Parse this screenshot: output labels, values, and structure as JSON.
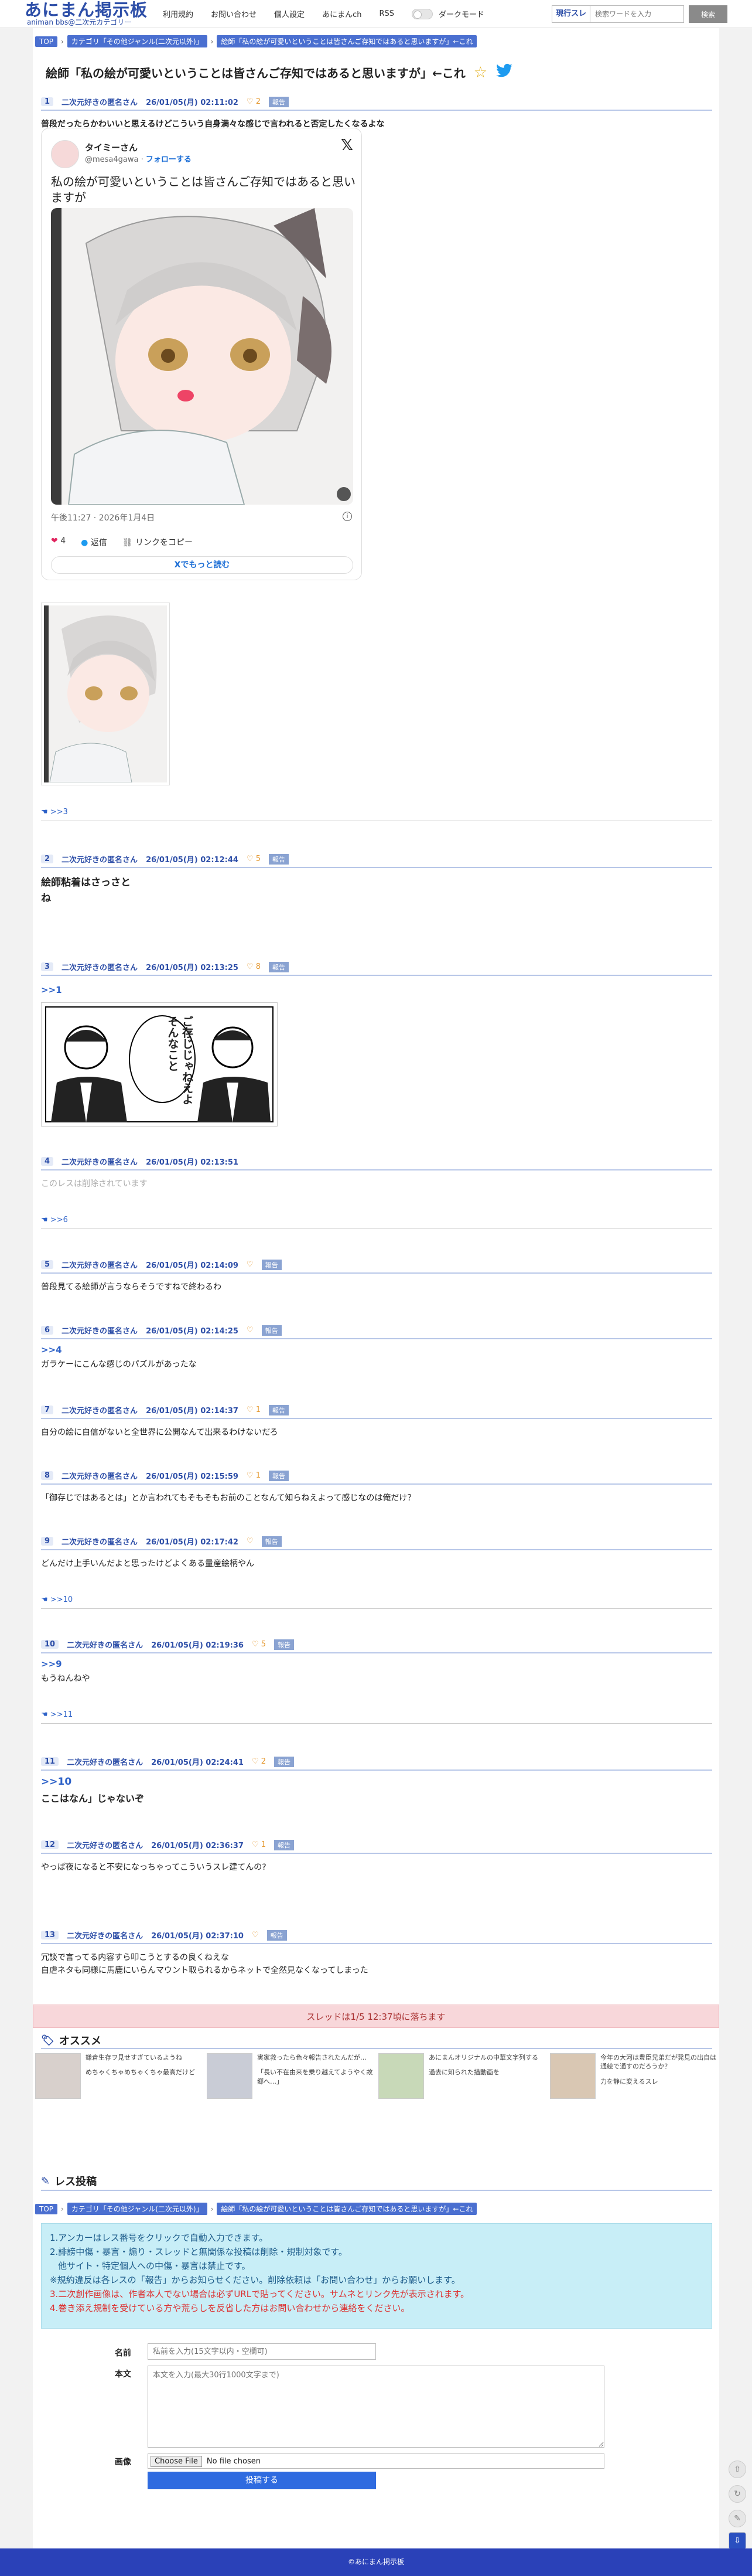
{
  "header": {
    "logo_title": "あにまん掲示板",
    "logo_sub": "animan bbs@二次元カテゴリー",
    "nav": [
      "利用規約",
      "お問い合わせ",
      "個人設定",
      "あにまんch",
      "RSS"
    ],
    "dark_mode": "ダークモード",
    "search_type": "現行スレ",
    "search_placeholder": "検索ワードを入力",
    "search_button": "検索"
  },
  "breadcrumb": {
    "top": "TOP",
    "category": "カテゴリ「その他ジャンル(二次元以外)」",
    "thread": "絵師「私の絵が可愛いということは皆さんご存知ではあると思いますが」←これ"
  },
  "thread_title": "絵師「私の絵が可愛いということは皆さんご存知ではあると思いますが」←これ",
  "report": "報告",
  "posts": [
    {
      "no": "1",
      "name": "二次元好きの匿名さん",
      "date": "26/01/05(月) 02:11:02",
      "likes": "2",
      "text": "普段だったらかわいいと思えるけどこういう自身満々な感じで言われると否定したくなるよな"
    },
    {
      "no": "2",
      "name": "二次元好きの匿名さん",
      "date": "26/01/05(月) 02:12:44",
      "likes": "5",
      "text": "絵師粘着はさっさと",
      "text2": "ね"
    },
    {
      "no": "3",
      "name": "二次元好きの匿名さん",
      "date": "26/01/05(月) 02:13:25",
      "likes": "8",
      "anchor": ">>1"
    },
    {
      "no": "4",
      "name": "二次元好きの匿名さん",
      "date": "26/01/05(月) 02:13:51",
      "text": "このレスは削除されています"
    },
    {
      "no": "5",
      "name": "二次元好きの匿名さん",
      "date": "26/01/05(月) 02:14:09",
      "text": "普段見てる絵師が言うならそうですねで終わるわ"
    },
    {
      "no": "6",
      "name": "二次元好きの匿名さん",
      "date": "26/01/05(月) 02:14:25",
      "anchor": ">>4",
      "text": "ガラケーにこんな感じのパズルがあったな"
    },
    {
      "no": "7",
      "name": "二次元好きの匿名さん",
      "date": "26/01/05(月) 02:14:37",
      "likes": "1",
      "text": "自分の絵に自信がないと全世界に公開なんて出来るわけないだろ"
    },
    {
      "no": "8",
      "name": "二次元好きの匿名さん",
      "date": "26/01/05(月) 02:15:59",
      "likes": "1",
      "text": "「御存じではあるとは」とか言われてもそもそもお前のことなんて知らねえよって感じなのは俺だけ？"
    },
    {
      "no": "9",
      "name": "二次元好きの匿名さん",
      "date": "26/01/05(月) 02:17:42",
      "text": "どんだけ上手いんだよと思ったけどよくある量産絵柄やん"
    },
    {
      "no": "10",
      "name": "二次元好きの匿名さん",
      "date": "26/01/05(月) 02:19:36",
      "likes": "5",
      "anchor": ">>9",
      "text": "もうねんねや"
    },
    {
      "no": "11",
      "name": "二次元好きの匿名さん",
      "date": "26/01/05(月) 02:24:41",
      "likes": "2",
      "anchor": ">>10",
      "text": "ここはなん」じゃないぞ"
    },
    {
      "no": "12",
      "name": "二次元好きの匿名さん",
      "date": "26/01/05(月) 02:36:37",
      "likes": "1",
      "text": "やっぱ夜になると不安になっちゃってこういうスレ建てんの?"
    },
    {
      "no": "13",
      "name": "二次元好きの匿名さん",
      "date": "26/01/05(月) 02:37:10",
      "text": "冗談で言ってる内容すら叩こうとするの良くねえな",
      "text2": "自虐ネタも同様に馬鹿にいらんマウント取られるからネットで全然見なくなってしまった"
    }
  ],
  "replies": {
    "r1": ">>3",
    "r4": ">>6",
    "r9": ">>10",
    "r10": ">>11"
  },
  "tweet": {
    "name": "タイミーさん",
    "handle": "@mesa4gawa",
    "follow": "フォローする",
    "text": "私の絵が可愛いということは皆さんご存知ではあると思いますが",
    "time": "午後11:27 · 2026年1月4日",
    "likes": "4",
    "reply": "返信",
    "copy": "リンクをコピー",
    "more": "Xでもっと読む"
  },
  "manga_text": "ご存じじゃねえよそんなこと",
  "deadline": "スレッドは1/5 12:37頃に落ちます",
  "recommend": {
    "title": "オススメ",
    "items": [
      {
        "t1": "鎌倉生存ヲ見せすぎているようね",
        "t2": "めちゃくちゃめちゃくちゃ最高だけど"
      },
      {
        "t1": "実家救ったら色々報告されたんだが…",
        "t2": "「長い不在由来を乗り越えてようやく故郷へ…」"
      },
      {
        "t1": "あにまんオリジナルの中華文字列する",
        "t2": "過去に知られた描動画を"
      },
      {
        "t1": "今年の大河は豊臣兄弟だが発見の出自は通絵で通すのだろうか？",
        "t2": "力を静に変えるスレ"
      }
    ]
  },
  "form": {
    "title": "レス投稿",
    "notices": [
      "1.アンカーはレス番号をクリックで自動入力できます。",
      "2.誹謗中傷・暴言・煽り・スレッドと無関係な投稿は削除・規制対象です。",
      "他サイト・特定個人への中傷・暴言は禁止です。",
      "※規約違反は各レスの「報告」からお知らせください。削除依頼は「お問い合わせ」からお願いします。",
      "3.二次創作画像は、作者本人でない場合は必ずURLで貼ってください。サムネとリンク先が表示されます。",
      "4.巻き添え規制を受けている方や荒らしを反省した方はお問い合わせから連絡をください。"
    ],
    "name_label": "名前",
    "name_placeholder": "私前を入力(15文字以内・空欄可)",
    "body_label": "本文",
    "body_placeholder": "本文を入力(最大30行1000文字まで)",
    "image_label": "画像",
    "file_button": "Choose File",
    "file_status": "No file chosen",
    "submit": "投稿する"
  },
  "footer": "©あにまん掲示板"
}
